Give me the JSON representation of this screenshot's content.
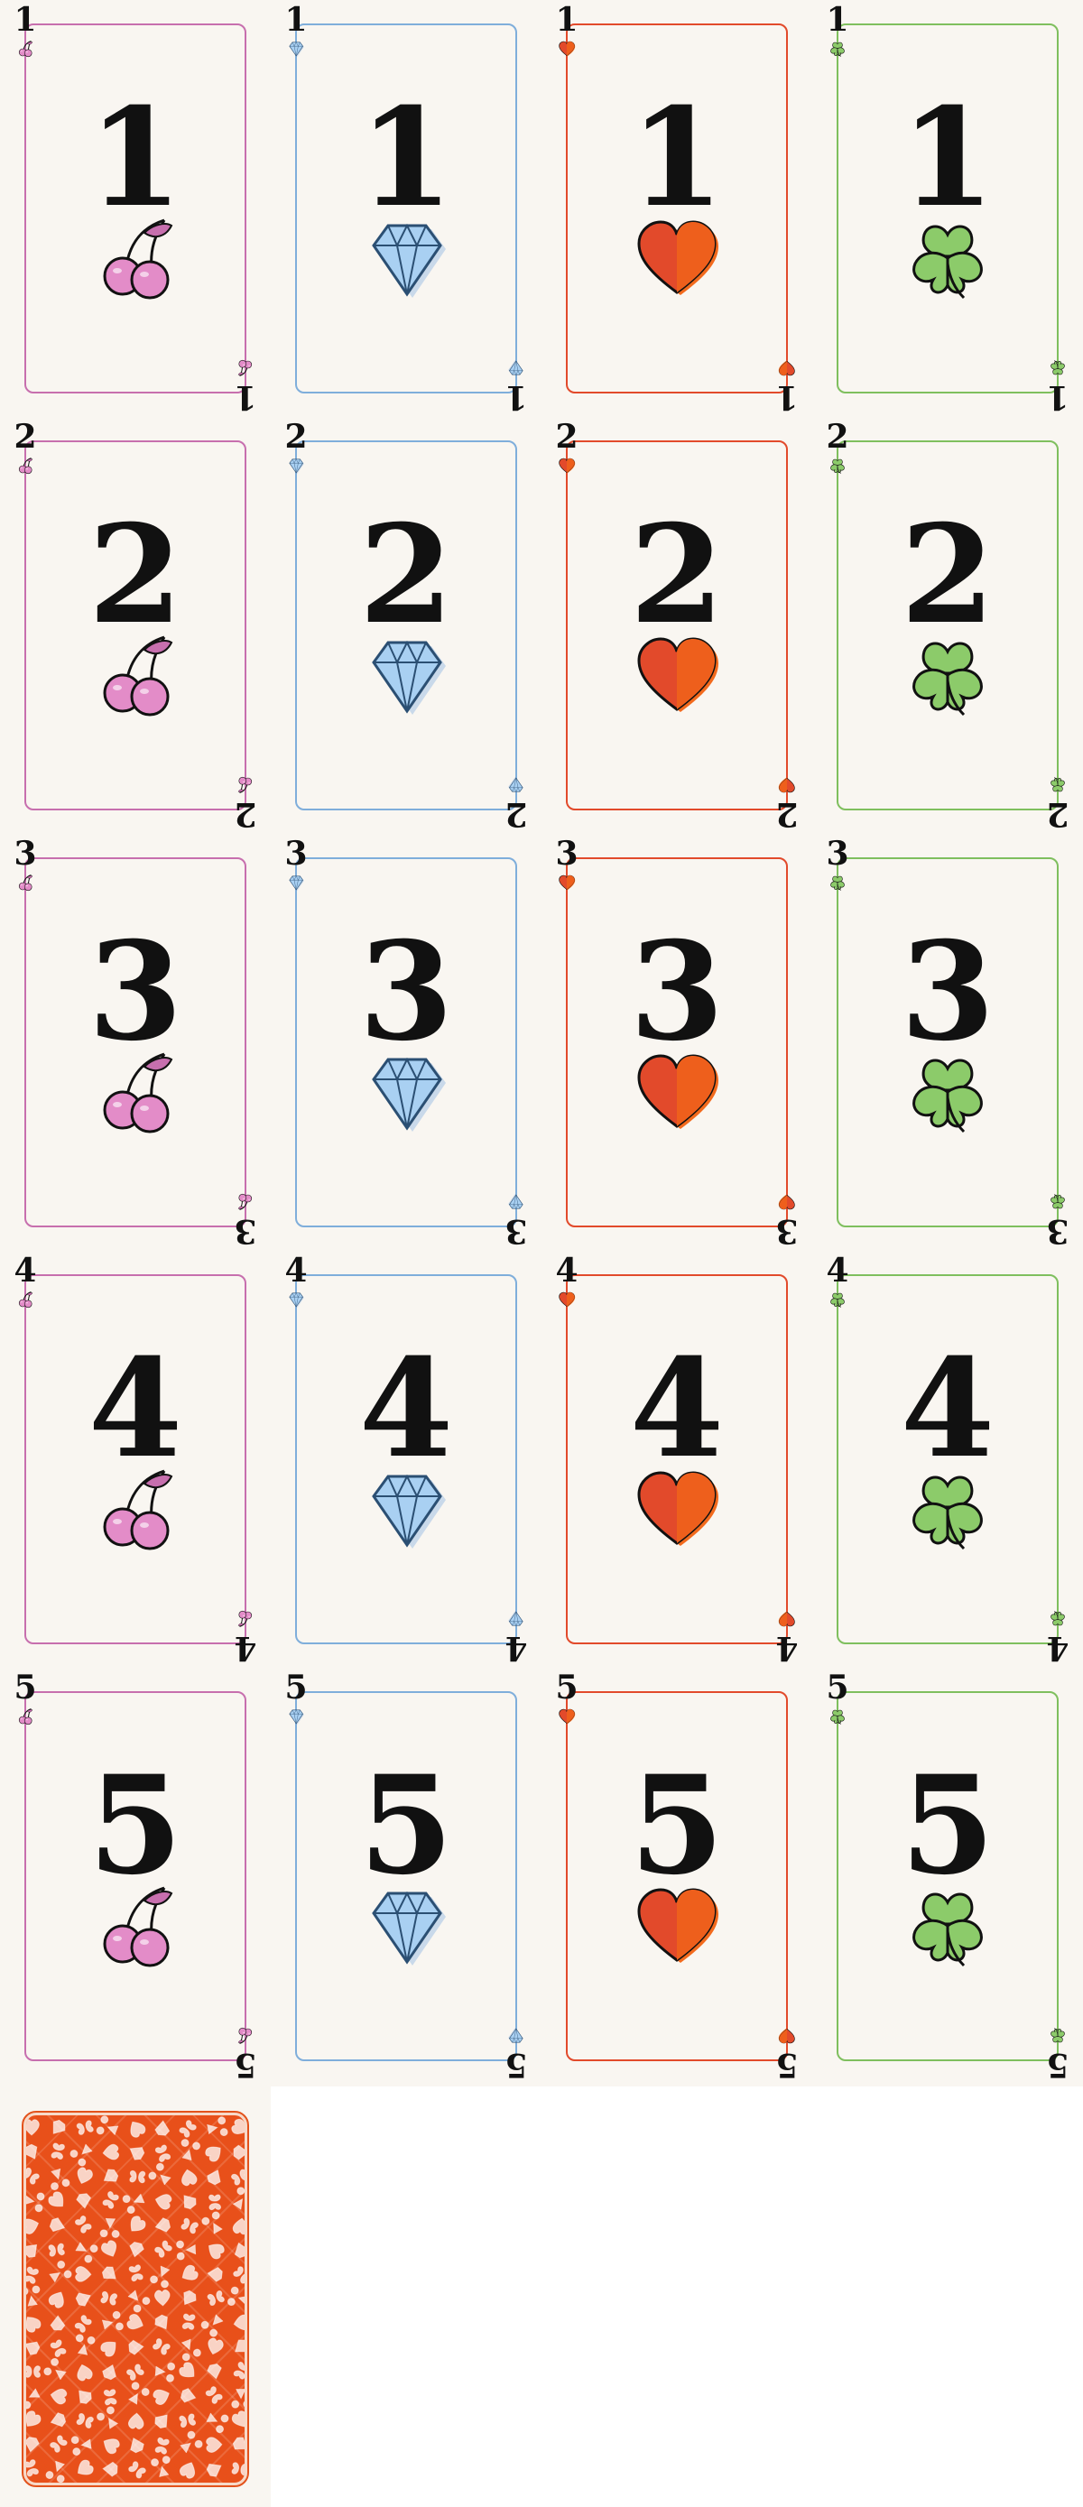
{
  "suits": [
    {
      "name": "cherry",
      "color": "#c76fae",
      "fill": "#e38cc8",
      "icon": "cherry-icon"
    },
    {
      "name": "diamond",
      "color": "#7faedb",
      "fill": "#a9d0f2",
      "icon": "diamond-icon"
    },
    {
      "name": "heart",
      "color": "#e24a2b",
      "fill": "#e24a2b",
      "icon": "heart-icon"
    },
    {
      "name": "clover",
      "color": "#7fbf5e",
      "fill": "#8ccb6a",
      "icon": "clover-icon"
    }
  ],
  "ranks": [
    "1",
    "2",
    "3",
    "4",
    "5"
  ],
  "card_back": {
    "color": "#e8501a",
    "pattern_icon": "heart-cherry-diamond-clover-pattern"
  }
}
